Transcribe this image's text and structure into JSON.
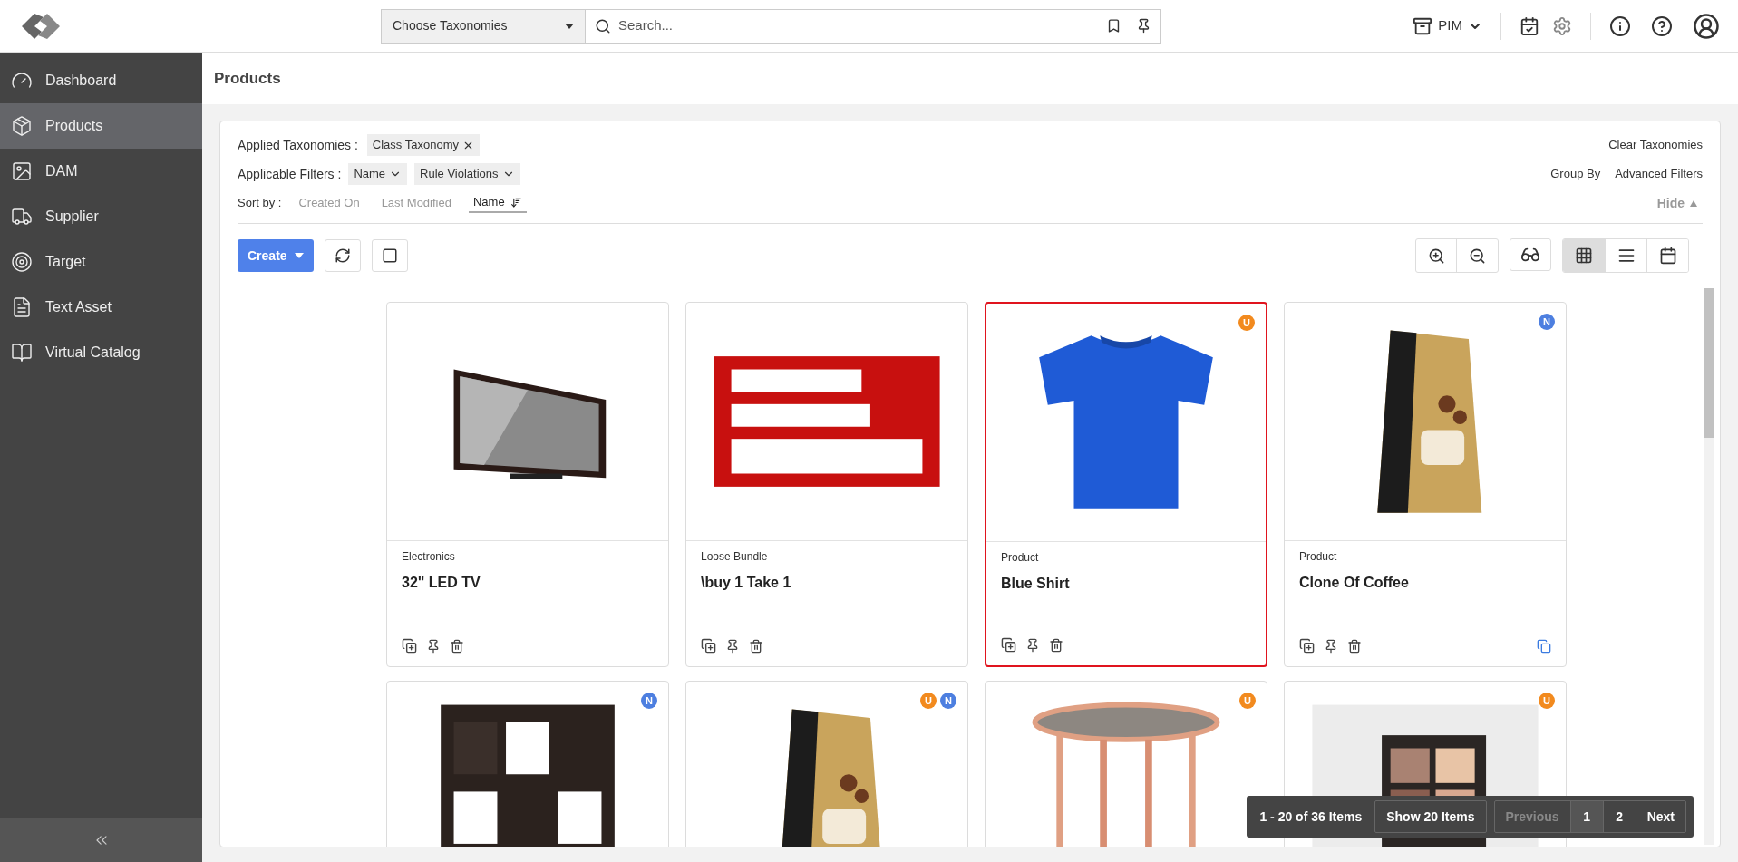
{
  "topbar": {
    "taxonomy_select": "Choose Taxonomies",
    "search": {
      "placeholder": "Search..."
    },
    "module": "PIM"
  },
  "sidebar": {
    "items": [
      {
        "label": "Dashboard",
        "selected": false
      },
      {
        "label": "Products",
        "selected": true
      },
      {
        "label": "DAM",
        "selected": false
      },
      {
        "label": "Supplier",
        "selected": false
      },
      {
        "label": "Target",
        "selected": false
      },
      {
        "label": "Text Asset",
        "selected": false
      },
      {
        "label": "Virtual Catalog",
        "selected": false
      }
    ]
  },
  "page_title": "Products",
  "filters": {
    "applied_label": "Applied Taxonomies :",
    "applied": [
      {
        "label": "Class Taxonomy"
      }
    ],
    "applicable_label": "Applicable Filters :",
    "applicable": [
      {
        "label": "Name"
      },
      {
        "label": "Rule Violations"
      }
    ],
    "sort_label": "Sort by :",
    "sort_options": [
      {
        "label": "Created On",
        "selected": false
      },
      {
        "label": "Last Modified",
        "selected": false
      },
      {
        "label": "Name",
        "selected": true
      }
    ],
    "clear": "Clear Taxonomies",
    "group_by": "Group By",
    "advanced": "Advanced Filters",
    "hide": "Hide"
  },
  "toolbar": {
    "create": "Create",
    "views": [
      {
        "kind": "grid",
        "selected": true
      },
      {
        "kind": "list",
        "selected": false
      },
      {
        "kind": "calendar",
        "selected": false
      }
    ]
  },
  "cards": [
    {
      "type": "Electronics",
      "name": "32\" LED TV",
      "selected": false,
      "copied": false
    },
    {
      "type": "Loose Bundle",
      "name": "\\buy 1 Take 1",
      "selected": false,
      "copied": false
    },
    {
      "type": "Product",
      "name": "Blue Shirt",
      "selected": true,
      "copied": false,
      "badges": [
        {
          "label": "U",
          "color": "#f28a1e"
        }
      ]
    },
    {
      "type": "Product",
      "name": "Clone Of Coffee",
      "selected": false,
      "copied": true,
      "badges": [
        {
          "label": "N",
          "color": "#4d7fe0"
        }
      ]
    },
    {
      "selected": false,
      "badges": [
        {
          "label": "N",
          "color": "#4d7fe0"
        }
      ]
    },
    {
      "selected": false,
      "badges": [
        {
          "label": "U",
          "color": "#f28a1e"
        },
        {
          "label": "N",
          "color": "#4d7fe0"
        }
      ]
    },
    {
      "selected": false,
      "badges": [
        {
          "label": "U",
          "color": "#f28a1e"
        }
      ]
    },
    {
      "selected": false,
      "badges": [
        {
          "label": "U",
          "color": "#f28a1e"
        }
      ]
    }
  ],
  "pagination": {
    "summary": "1 - 20 of 36 Items",
    "page_size": "Show 20 Items",
    "previous": {
      "label": "Previous",
      "disabled": true
    },
    "pages": [
      {
        "label": "1",
        "selected": true
      },
      {
        "label": "2",
        "selected": false
      }
    ],
    "next": {
      "label": "Next",
      "disabled": false
    }
  }
}
